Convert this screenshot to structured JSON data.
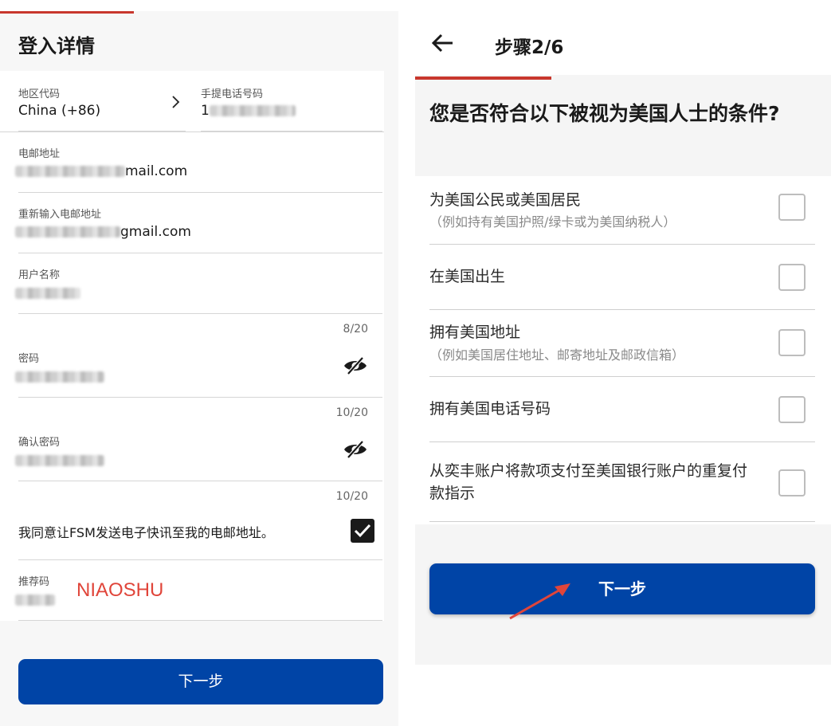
{
  "left": {
    "title": "登入详情",
    "region_code": {
      "label": "地区代码",
      "value": "China (+86)"
    },
    "phone": {
      "label": "手提电话号码",
      "value_prefix": "1"
    },
    "email": {
      "label": "电邮地址",
      "value_suffix": "mail.com"
    },
    "email_confirm": {
      "label": "重新输入电邮地址",
      "value_suffix": "gmail.com"
    },
    "username": {
      "label": "用户名称",
      "counter": "8/20"
    },
    "password": {
      "label": "密码",
      "counter": "10/20"
    },
    "password_confirm": {
      "label": "确认密码",
      "counter": "10/20"
    },
    "newsletter_consent": {
      "label": "我同意让FSM发送电子快讯至我的电邮地址。",
      "checked": true
    },
    "referral": {
      "label": "推荐码",
      "annotation": "NIAOSHU"
    },
    "next_button": "下一步"
  },
  "right": {
    "step": "步骤2/6",
    "question": "您是否符合以下被视为美国人士的条件?",
    "options": [
      {
        "label": "为美国公民或美国居民",
        "hint": "（例如持有美国护照/绿卡或为美国纳税人）",
        "checked": false
      },
      {
        "label": "在美国出生",
        "hint": "",
        "checked": false
      },
      {
        "label": "拥有美国地址",
        "hint": "（例如美国居住地址、邮寄地址及邮政信箱）",
        "checked": false
      },
      {
        "label": "拥有美国电话号码",
        "hint": "",
        "checked": false
      },
      {
        "label": "从奕丰账户将款项支付至美国银行账户的重复付款指示",
        "hint": "",
        "checked": false
      }
    ],
    "next_button": "下一步"
  },
  "colors": {
    "accent_red": "#c8372d",
    "primary_blue": "#0044a6",
    "annotation_red": "#e0453a"
  }
}
